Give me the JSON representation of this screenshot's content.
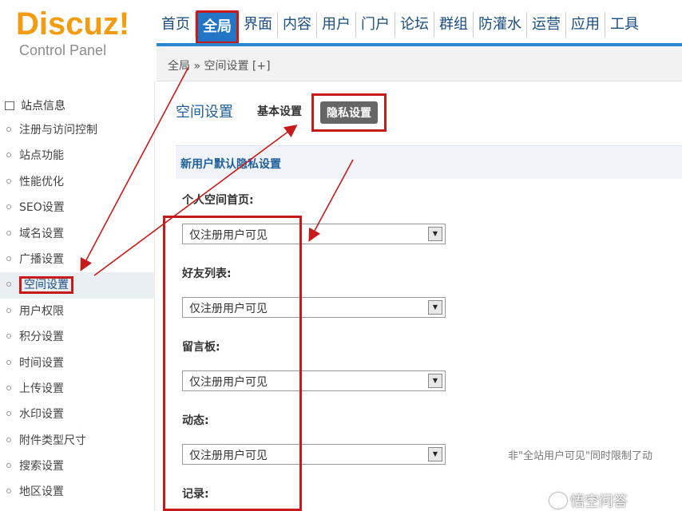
{
  "logo": {
    "main": "Discuz!",
    "sub": "Control Panel"
  },
  "topnav": [
    "首页",
    "全局",
    "界面",
    "内容",
    "用户",
    "门户",
    "论坛",
    "群组",
    "防灌水",
    "运营",
    "应用",
    "工具"
  ],
  "breadcrumb": "全局 » 空间设置  [+]",
  "sidebar": {
    "head": "站点信息",
    "items": [
      "注册与访问控制",
      "站点功能",
      "性能优化",
      "SEO设置",
      "域名设置",
      "广播设置",
      "空间设置",
      "用户权限",
      "积分设置",
      "时间设置",
      "上传设置",
      "水印设置",
      "附件类型尺寸",
      "搜索设置",
      "地区设置"
    ]
  },
  "main": {
    "title": "空间设置",
    "tab_basic": "基本设置",
    "tab_privacy": "隐私设置",
    "section_title": "新用户默认隐私设置",
    "fields": [
      {
        "label": "个人空间首页:",
        "value": "仅注册用户可见"
      },
      {
        "label": "好友列表:",
        "value": "仅注册用户可见"
      },
      {
        "label": "留言板:",
        "value": "仅注册用户可见"
      },
      {
        "label": "动态:",
        "value": "仅注册用户可见"
      },
      {
        "label": "记录:",
        "value": ""
      }
    ],
    "hint": "非\"全站用户可见\"同时限制了动"
  },
  "watermark": "悟空问答",
  "colors": {
    "accent": "#2376c6",
    "annotation": "#c71a1a",
    "logo": "#f39c12"
  }
}
